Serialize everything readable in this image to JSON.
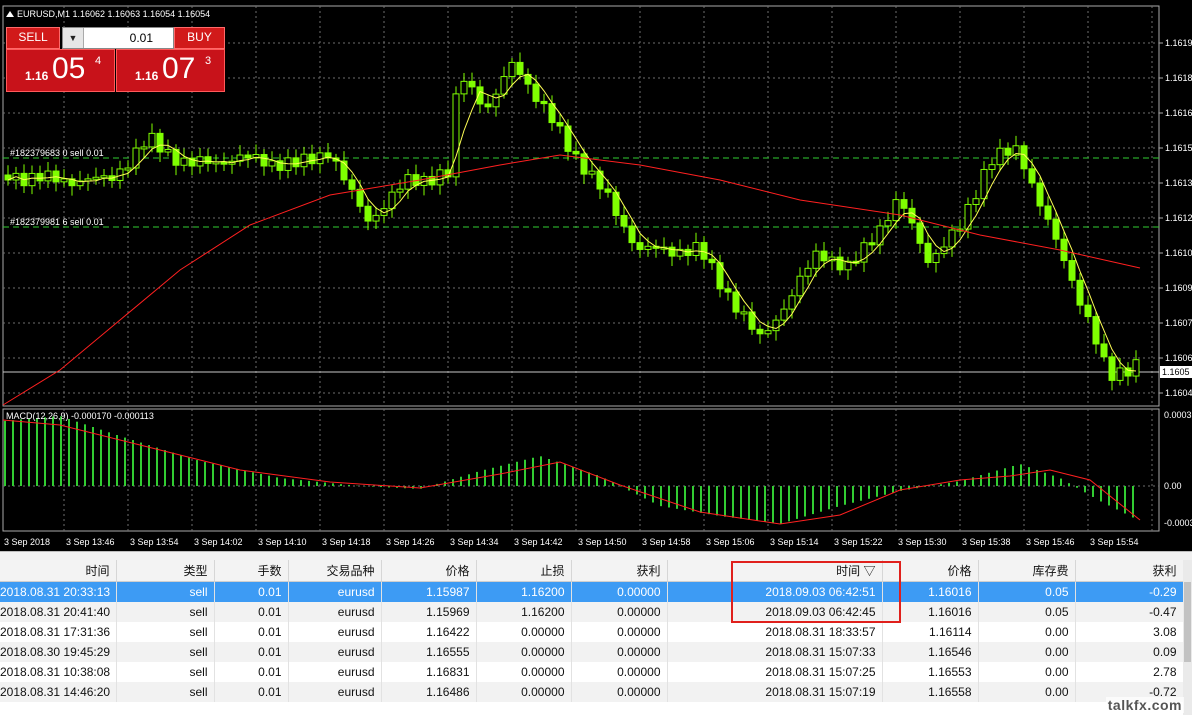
{
  "chart": {
    "symbol_line": "EURUSD,M1  1.16062 1.16063 1.16054 1.16054",
    "macd_label": "MACD(12,26,9) -0.000170 -0.000113",
    "order_labels": [
      "#182379683 0 sell 0.01",
      "#182379981 6 sell 0.01"
    ],
    "price_ticks": [
      "1.1619",
      "1.1618",
      "1.1616",
      "1.1615",
      "1.1613",
      "1.1612",
      "1.1610",
      "1.1609",
      "1.1607",
      "1.1606",
      "1.1604"
    ],
    "current_price": "1.1605",
    "macd_ticks": [
      "0.00031",
      "0.00",
      "-0.00031"
    ],
    "time_ticks": [
      "3 Sep 2018",
      "3 Sep 13:46",
      "3 Sep 13:54",
      "3 Sep 14:02",
      "3 Sep 14:10",
      "3 Sep 14:18",
      "3 Sep 14:26",
      "3 Sep 14:34",
      "3 Sep 14:42",
      "3 Sep 14:50",
      "3 Sep 14:58",
      "3 Sep 15:06",
      "3 Sep 15:14",
      "3 Sep 15:22",
      "3 Sep 15:30",
      "3 Sep 15:38",
      "3 Sep 15:46",
      "3 Sep 15:54"
    ],
    "colors": {
      "background": "#000000",
      "up_candle": "#ffffff",
      "candle": "#7fff00",
      "ma_fast": "#ffff55",
      "ma_slow": "#ff2020",
      "grid": "#6e6e6e",
      "order_line": "#32cd32",
      "macd_hist": "#32cd32",
      "macd_signal": "#ff2020"
    }
  },
  "oneclick": {
    "sell_label": "SELL",
    "buy_label": "BUY",
    "lot_value": "0.01",
    "lot_arrow_icon": "chevron-down-icon",
    "sell_price_prefix": "1.16",
    "sell_price_big": "05",
    "sell_price_sup": "4",
    "buy_price_prefix": "1.16",
    "buy_price_big": "07",
    "buy_price_sup": "3"
  },
  "table": {
    "columns": [
      "时间",
      "类型",
      "手数",
      "交易品种",
      "价格",
      "止损",
      "获利",
      "时间 ▽",
      "价格",
      "库存费",
      "获利"
    ],
    "rows": [
      [
        "2018.08.31 20:33:13",
        "sell",
        "0.01",
        "eurusd",
        "1.15987",
        "1.16200",
        "0.00000",
        "2018.09.03 06:42:51",
        "1.16016",
        "0.05",
        "-0.29"
      ],
      [
        "2018.08.31 20:41:40",
        "sell",
        "0.01",
        "eurusd",
        "1.15969",
        "1.16200",
        "0.00000",
        "2018.09.03 06:42:45",
        "1.16016",
        "0.05",
        "-0.47"
      ],
      [
        "2018.08.31 17:31:36",
        "sell",
        "0.01",
        "eurusd",
        "1.16422",
        "0.00000",
        "0.00000",
        "2018.08.31 18:33:57",
        "1.16114",
        "0.00",
        "3.08"
      ],
      [
        "2018.08.30 19:45:29",
        "sell",
        "0.01",
        "eurusd",
        "1.16555",
        "0.00000",
        "0.00000",
        "2018.08.31 15:07:33",
        "1.16546",
        "0.00",
        "0.09"
      ],
      [
        "2018.08.31 10:38:08",
        "sell",
        "0.01",
        "eurusd",
        "1.16831",
        "0.00000",
        "0.00000",
        "2018.08.31 15:07:25",
        "1.16553",
        "0.00",
        "2.78"
      ],
      [
        "2018.08.31 14:46:20",
        "sell",
        "0.01",
        "eurusd",
        "1.16486",
        "0.00000",
        "0.00000",
        "2018.08.31 15:07:19",
        "1.16558",
        "0.00",
        "-0.72"
      ]
    ],
    "selected_row": 0
  },
  "watermark": "talkfx.com"
}
